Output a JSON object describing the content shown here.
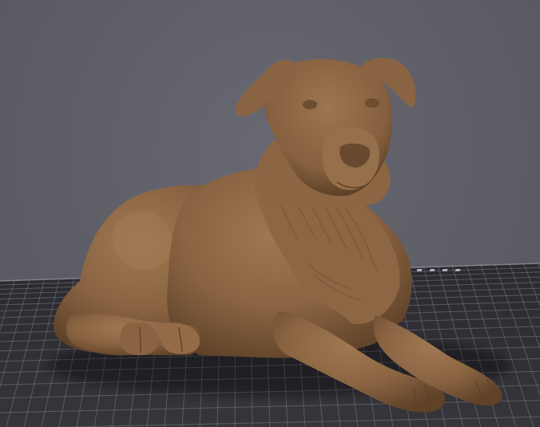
{
  "viewport": {
    "background_color": "#5e5e67",
    "bed_color": "#2f2f34",
    "grid_line_color": "#8c8c96",
    "model_color": "#8f6a47"
  },
  "build_plate": {
    "label_text": "▬ ▬ ▬ ▬"
  },
  "model": {
    "subject": "lying-dog-sculpture"
  }
}
